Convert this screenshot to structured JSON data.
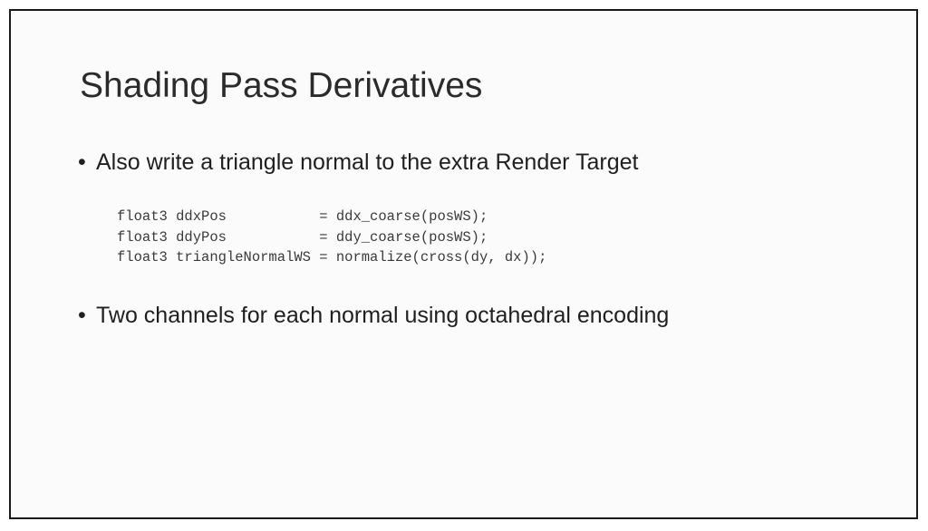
{
  "slide": {
    "title": "Shading Pass Derivatives",
    "bullet_glyph": "•",
    "bullets": [
      {
        "text": "Also write a triangle normal to the extra Render Target"
      },
      {
        "text": "Two channels for each normal using octahedral encoding"
      }
    ],
    "code_lines": [
      "float3 ddxPos           = ddx_coarse(posWS);",
      "float3 ddyPos           = ddy_coarse(posWS);",
      "float3 triangleNormalWS = normalize(cross(dy, dx));"
    ]
  }
}
